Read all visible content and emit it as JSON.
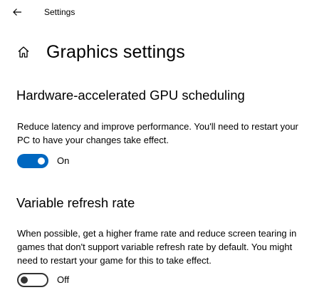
{
  "window": {
    "title": "Settings",
    "back_icon": "back-arrow-icon"
  },
  "header": {
    "home_icon": "home-icon",
    "title": "Graphics settings"
  },
  "gpu_scheduling": {
    "title": "Hardware-accelerated GPU scheduling",
    "description_line1": "Reduce latency and improve performance. You'll need to restart your",
    "description_line2": "PC to have your changes take effect.",
    "toggle_state": "on",
    "toggle_label": "On",
    "accent_color": "#0067c0"
  },
  "variable_refresh": {
    "title": "Variable refresh rate",
    "description_line1": "When possible, get a higher frame rate and reduce screen tearing in",
    "description_line2": "games that don't support variable refresh rate by default. You might",
    "description_line3": "need to restart your game for this to take effect.",
    "toggle_state": "off",
    "toggle_label": "Off"
  }
}
